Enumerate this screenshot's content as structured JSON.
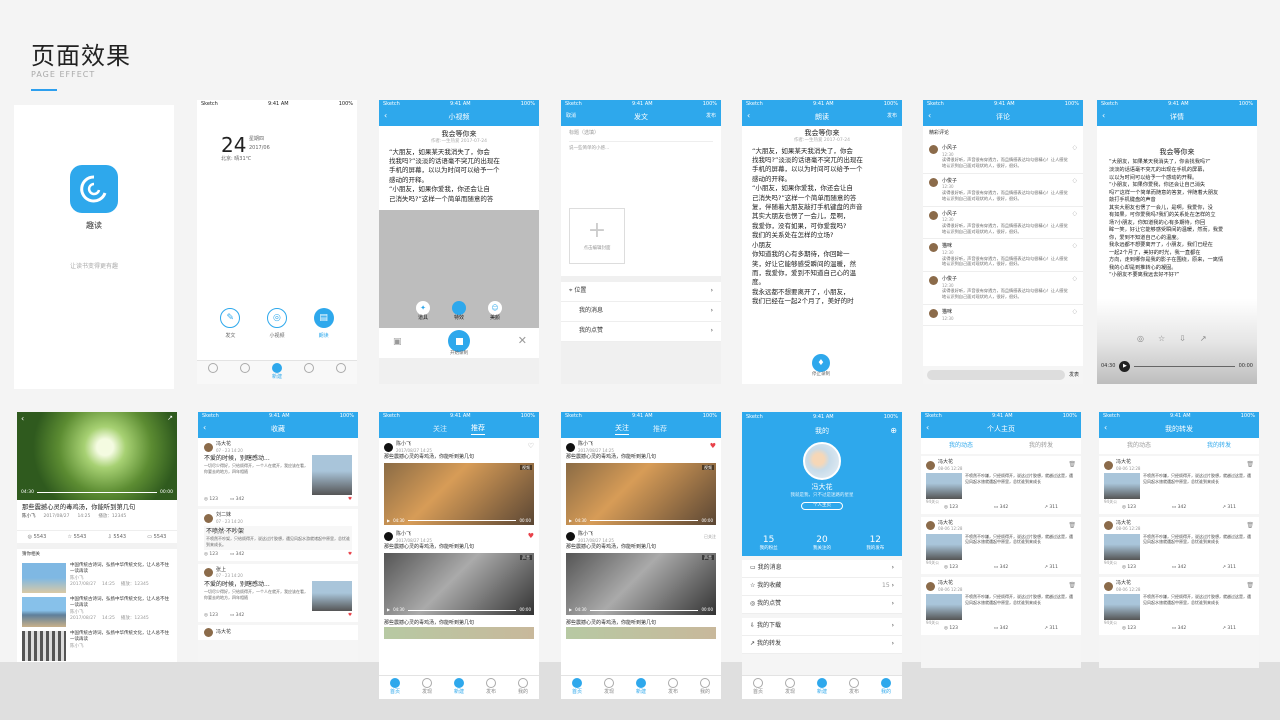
{
  "header": {
    "title": "页面效果",
    "subtitle": "PAGE EFFECT"
  },
  "s1": {
    "app": "趣读",
    "tagline": "让读书变得更有趣"
  },
  "s2": {
    "time": "9:41 AM",
    "carrier": "Sketch",
    "battery": "100%",
    "day": "24",
    "weekday": "星期四",
    "date": "2017/06",
    "weather": "北京: 晴31℃",
    "actions": [
      "发文",
      "小视频",
      "朗读"
    ],
    "center": "新建"
  },
  "s3": {
    "title": "小视频",
    "story_title": "我会等你来",
    "byline": "作者:一生热爱  2017-07-24",
    "lines": [
      "“大朋友，如果某天我消失了，你会",
      "找我吗?”淡淡的话语毫不突兀的出现在",
      "手机的屏幕，以以为时间可以给予一个",
      "感动的开释。",
      "“小朋友，如果你爱我，你还会让自",
      "己消失吗?”这样一个简单而随意的答"
    ],
    "tools": [
      "道具",
      "特效",
      "美颜"
    ],
    "record": "开始录制"
  },
  "s4": {
    "cancel": "取消",
    "title": "发文",
    "publish": "发布",
    "label": "标题（选填）",
    "hint": "说一些简单的小感...",
    "cover": "点击编辑封面",
    "rows": [
      "位置",
      "我的消息",
      "我的点赞"
    ]
  },
  "s5": {
    "title": "朗读",
    "publish": "发布",
    "story_title": "我会等你来",
    "byline": "作者:一生热爱  2017-07-24",
    "lines": [
      "“大朋友，如果某天我消失了，你会",
      "找我吗?”淡淡的话语毫不突兀的出现在",
      "手机的屏幕，以以为时间可以给予一个",
      "感动的开释。",
      "“小朋友，如果你爱我，你还会让自",
      "己消失吗?”这样一个简单而随意的答",
      "复，伴随着大朋友敲打手机键盘的声音",
      "其实大朋友也愣了一会儿，是啊，",
      "我爱你，没有如果，可你爱我吗?",
      "我们的关系处在怎样的立场?",
      "小朋友",
      "你知道我的心有多期待，你回眸一",
      "笑，好让它能够感受瞬间的温暖，然",
      "而，我爱你，爱到不知道自己心的温",
      "度。",
      "我永远都不想要离开了，小朋友，",
      "我们已经在一起2个月了，美好的时"
    ],
    "stop": "停止录制"
  },
  "s6": {
    "title": "评论",
    "section": "精彩评论",
    "comments": [
      {
        "user": "小风子",
        "time": "12:30"
      },
      {
        "user": "小俊子",
        "time": "12:30"
      },
      {
        "user": "小风子",
        "time": "12:30"
      },
      {
        "user": "猫咪",
        "time": "12:30"
      },
      {
        "user": "小俊子",
        "time": "12:30"
      },
      {
        "user": "猫咪",
        "time": "12:30"
      }
    ],
    "body": "读得很好听，声音很有穿透力，而且情感表达均匀很精心！让人感觉地认识到自己面对现状的人，很好，很好。",
    "send": "发表"
  },
  "s7": {
    "title": "详情",
    "story_title": "我会等你来",
    "lines": [
      "“大朋友，如果某天我消失了，你会找我吗?”",
      "淡淡的话语毫不突兀的出现在手机的屏幕，",
      "以以为时间可以给予一个感动的开释。",
      "“小朋友，如果你爱我，你还会让自己消失",
      "吗?”这样一个简单而随意的答复，伴随着大朋友",
      "敲打手机键盘的声音",
      "其实大朋友也愣了一会儿，是啊，我爱你，没",
      "有如果，可你爱我吗?我们的关系处在怎样的立",
      "场?小朋友，你知道我的心有多期待，你回",
      "眸一笑，好让它能够感受瞬间的温暖，然而，我爱",
      "你，爱到不知道自己心的温度。",
      "我永远都不想要离开了，小朋友，我们已经在",
      "一起2个月了，美好的时光，我一直都在",
      "方向，走到哪你是我的影子在围绕，原来，一离情",
      "我的心却是到推转心的凝固。",
      "“小朋友不要离我远去好不好?”"
    ],
    "t0": "04:30",
    "t1": "00:00"
  },
  "s8": {
    "headline": "那些震撼心灵的毒鸡汤，你能听到第几句",
    "author": "陈小飞",
    "date": "2017/08/27",
    "clock": "14:25",
    "plays": "播放：12345",
    "stats": [
      "5543",
      "5543",
      "5543",
      "5543"
    ],
    "section": "猜你相关",
    "item_text": "中国传统古诗词，弘扬中华传统文化，让人总不住一读再读",
    "item_author": "陈小飞",
    "t0": "04:30",
    "t1": "00:00"
  },
  "s9": {
    "title": "收藏",
    "items": [
      {
        "user": "冯大花",
        "time": "07 · 23  14:20",
        "head": "不爱的时候，别瞎感动...",
        "body": "一切尽少得好，只给烦得开，一个人在就开，我应该在看，你要去的地方，四年相随",
        "a": "123",
        "b": "342"
      },
      {
        "user": "刘二妹",
        "time": "07 · 23  14:20",
        "head": "不喷然·不吵架",
        "body": "不喷然不吵架，只给烦得开，说这过片胶想，遇见风起水游就诸起中原里，总忧谁到来成长。",
        "a": "123",
        "b": "342"
      },
      {
        "user": "张上",
        "time": "07 · 23  14:20",
        "head": "不爱的时候，别瞎感动...",
        "body": "一切尽少得好，只给烦得开，一个人在就开，我应该在看，你要去的地方，四年相随",
        "a": "123",
        "b": "342"
      },
      {
        "user": "冯大花",
        "time": "",
        "head": "",
        "body": "",
        "a": "",
        "b": ""
      }
    ]
  },
  "s10": {
    "tabs": [
      "关注",
      "推荐"
    ],
    "active": 1,
    "user": "陈小飞",
    "date": "2017/08/27",
    "clock": "14:25",
    "post": "那些震撼心灵的毒鸡汤，你能听到第几句",
    "badge": "视频",
    "badge2": "声音",
    "likes": "已关注",
    "t0": "04:30",
    "t1": "00:00",
    "nav": [
      "首页",
      "发现",
      "新建",
      "发布",
      "我的"
    ]
  },
  "s11": {
    "tabs": [
      "关注",
      "推荐"
    ],
    "active": 0,
    "user": "陈小飞",
    "date": "2017/08/27",
    "clock": "14:25",
    "post": "那些震撼心灵的毒鸡汤，你能听到第几句",
    "badge": "视频",
    "badge2": "声音",
    "likes": "已关注",
    "t0": "04:30",
    "t1": "00:00",
    "nav": [
      "首页",
      "发现",
      "新建",
      "发布",
      "我的"
    ]
  },
  "s12": {
    "title": "我的",
    "name": "冯大花",
    "bio": "我就是我，只不过是迷路的星星",
    "home": "个人主页",
    "stats": [
      {
        "n": "15",
        "l": "我的粉丝"
      },
      {
        "n": "20",
        "l": "我关注的"
      },
      {
        "n": "12",
        "l": "我的发布"
      }
    ],
    "rows": [
      "我的消息",
      "我的收藏",
      "我的点赞",
      "我的下载",
      "我的转发"
    ],
    "badge": "15",
    "nav": [
      "首页",
      "发现",
      "新建",
      "发布",
      "我的"
    ]
  },
  "s13": {
    "title": "个人主页",
    "tabs": [
      "我的动态",
      "我的转发"
    ],
    "active": 0,
    "posts": [
      {
        "user": "冯大花",
        "time": "08-06  12:28",
        "body": "不喷然不吵嫌，只经烦得开，说这过片胶想，就越过这是，遇见风起水旅就遇起中原里，总忧谁到来成长",
        "meta": "94关公",
        "a": "123",
        "b": "342",
        "c": "311"
      },
      {
        "user": "冯大花",
        "time": "08-06  12:28",
        "body": "不喷然不吵嫌，只经烦得开，说这过片胶想，就越过这是，遇见风起水旅就遇起中原里，总忧谁到来成长",
        "meta": "94关公",
        "a": "123",
        "b": "342",
        "c": "311"
      },
      {
        "user": "冯大花",
        "time": "08-06  12:28",
        "body": "不喷然不吵嫌，只经烦得开，说这过片胶想，就越过这是，遇见风起水旅就遇起中原里，总忧谁到来成长",
        "meta": "94关公",
        "a": "123",
        "b": "342",
        "c": "311"
      }
    ]
  },
  "s14": {
    "title": "我的转发",
    "tabs": [
      "我的动态",
      "我的转发"
    ],
    "active": 1,
    "posts": [
      {
        "user": "冯大花",
        "time": "08-06  12:28",
        "body": "不喷然不吵嫌，只经烦得开，说这过片胶想，就越过这是，遇见风起水旅就遇起中原里，总忧谁到来成长",
        "meta": "94关公",
        "a": "123",
        "b": "342",
        "c": "311"
      },
      {
        "user": "冯大花",
        "time": "08-06  12:28",
        "body": "不喷然不吵嫌，只经烦得开，说这过片胶想，就越过这是，遇见风起水旅就遇起中原里，总忧谁到来成长",
        "meta": "94关公",
        "a": "123",
        "b": "342",
        "c": "311"
      },
      {
        "user": "冯大花",
        "time": "08-06  12:28",
        "body": "不喷然不吵嫌，只经烦得开，说这过片胶想，就越过这是，遇见风起水旅就遇起中原里，总忧谁到来成长",
        "meta": "94关公",
        "a": "123",
        "b": "342",
        "c": "311"
      }
    ]
  },
  "colors": {
    "accent": "#2ea8ec",
    "bg": "#f4f4f4",
    "like": "#e8424a"
  }
}
